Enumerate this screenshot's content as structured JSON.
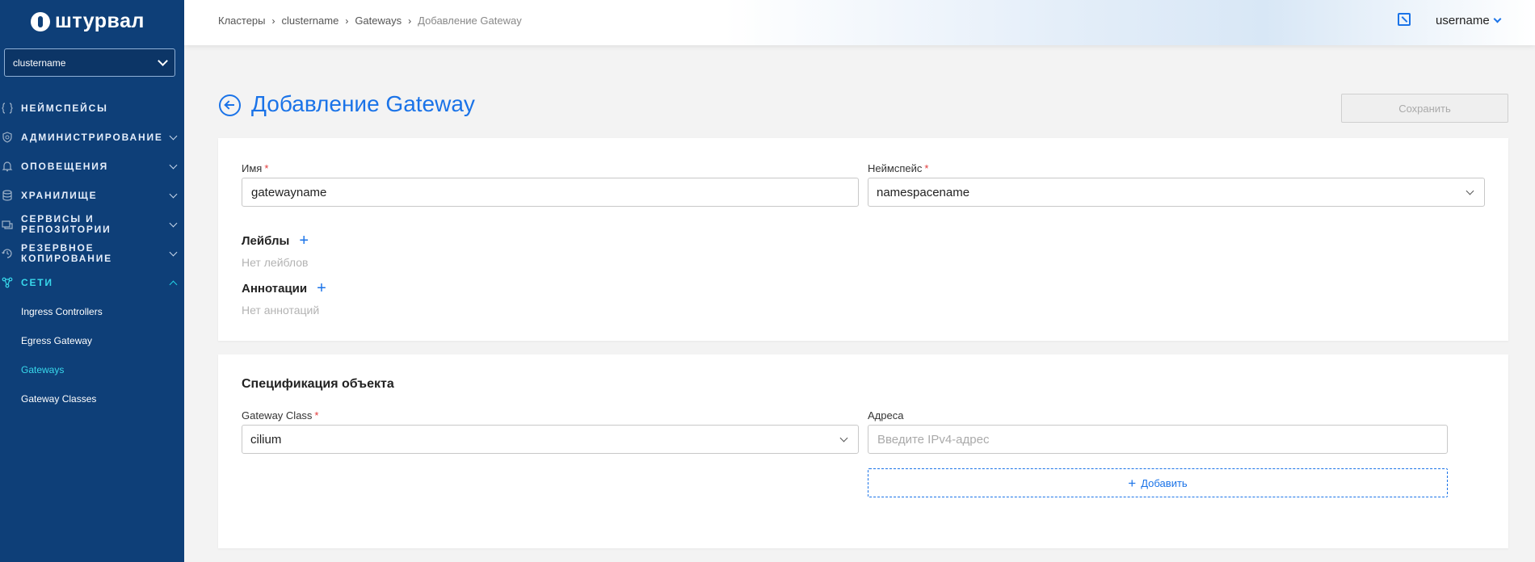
{
  "app": {
    "logo_text": "штурвал"
  },
  "sidebar": {
    "cluster_select": "clustername",
    "items": [
      {
        "label": "НЕЙМСПЕЙСЫ",
        "icon": "braces-icon",
        "has_arrow": false
      },
      {
        "label": "АДМИНИСТРИРОВАНИЕ",
        "icon": "shield-gear-icon",
        "has_arrow": true
      },
      {
        "label": "ОПОВЕЩЕНИЯ",
        "icon": "bell-icon",
        "has_arrow": true
      },
      {
        "label": "ХРАНИЛИЩЕ",
        "icon": "database-icon",
        "has_arrow": true
      },
      {
        "label": "СЕРВИСЫ И РЕПОЗИТОРИИ",
        "icon": "services-icon",
        "has_arrow": true
      },
      {
        "label": "РЕЗЕРВНОЕ КОПИРОВАНИЕ",
        "icon": "backup-icon",
        "has_arrow": true
      },
      {
        "label": "СЕТИ",
        "icon": "network-icon",
        "has_arrow": true,
        "active": true
      }
    ],
    "sub_items": [
      {
        "label": "Ingress Controllers"
      },
      {
        "label": "Egress Gateway"
      },
      {
        "label": "Gateways",
        "active": true
      },
      {
        "label": "Gateway Classes"
      }
    ]
  },
  "header": {
    "breadcrumb": [
      "Кластеры",
      "clustername",
      "Gateways",
      "Добавление Gateway"
    ],
    "username": "username"
  },
  "page": {
    "title": "Добавление Gateway",
    "save_label": "Сохранить"
  },
  "form": {
    "name_label": "Имя",
    "name_value": "gatewayname",
    "namespace_label": "Неймспейс",
    "namespace_value": "namespacename",
    "labels_title": "Лейблы",
    "labels_empty": "Нет лейблов",
    "annotations_title": "Аннотации",
    "annotations_empty": "Нет аннотаций",
    "required_mark": "*"
  },
  "spec": {
    "title": "Спецификация объекта",
    "gateway_class_label": "Gateway Class",
    "gateway_class_value": "cilium",
    "addresses_label": "Адреса",
    "address_placeholder": "Введите IPv4-адрес",
    "add_label": "Добавить"
  },
  "colors": {
    "sidebar_bg": "#0e3f78",
    "accent": "#1a73e8",
    "active_nav": "#38d9ec",
    "required": "#e23a3a"
  }
}
